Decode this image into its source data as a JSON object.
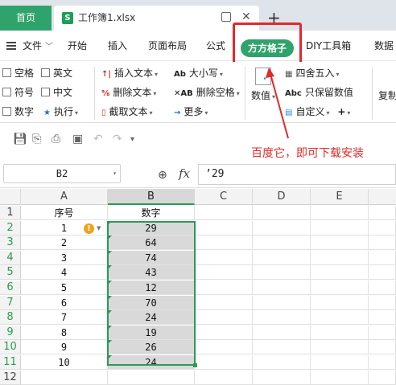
{
  "tabs": {
    "home": "首页",
    "file": "工作簿1.xlsx",
    "file_icon": "S",
    "new_tab": "+"
  },
  "menu": {
    "file": "文件",
    "items": [
      "开始",
      "插入",
      "页面布局",
      "公式",
      "方方格子",
      "DIY工具箱",
      "数据"
    ]
  },
  "ribbon": {
    "checks": [
      "空格",
      "英文",
      "符号",
      "中文",
      "数字"
    ],
    "execute": "执行",
    "insert_text": "插入文本",
    "delete_text": "删除文本",
    "cut_text": "截取文本",
    "case": "大小写",
    "delete_space": "删除空格",
    "more": "更多",
    "numeric": "数值",
    "round": "四舍五入",
    "keep_value": "只保留数值",
    "custom": "自定义",
    "copy": "复制"
  },
  "annotation": "百度它，即可下载安装",
  "formula_bar": {
    "cell_ref": "B2",
    "formula": "’29",
    "fx": "fx"
  },
  "sheet": {
    "columns": [
      "A",
      "B",
      "C",
      "D",
      "E"
    ],
    "rows": [
      "1",
      "2",
      "3",
      "4",
      "5",
      "6",
      "7",
      "8",
      "9",
      "10",
      "11",
      "12"
    ],
    "header_a": "序号",
    "header_b": "数字",
    "col_a": [
      "1",
      "2",
      "3",
      "4",
      "5",
      "6",
      "7",
      "8",
      "9",
      "10"
    ],
    "col_b": [
      "29",
      "64",
      "74",
      "43",
      "12",
      "70",
      "24",
      "19",
      "26",
      "24"
    ]
  },
  "colors": {
    "accent": "#2fa36b",
    "highlight": "#e02a2a",
    "selection": "#2b9a53"
  }
}
